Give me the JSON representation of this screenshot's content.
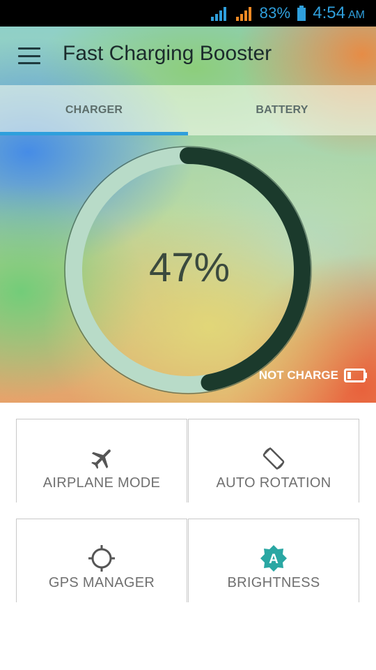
{
  "status_bar": {
    "battery_percent": "83%",
    "time": "4:54",
    "ampm": "AM",
    "color": "#2f9fdc"
  },
  "header": {
    "title": "Fast Charging Booster",
    "menu_icon": "hamburger-menu-icon"
  },
  "tabs": [
    {
      "label": "CHARGER",
      "selected": true
    },
    {
      "label": "BATTERY",
      "selected": false
    }
  ],
  "gauge": {
    "percent_text": "47%",
    "level": 0.47,
    "filled_color": "#1b3a2c",
    "track_color": "#b8dbc8",
    "status_text": "NOT CHARGE",
    "status_icon": "battery-outline-icon"
  },
  "toggles": [
    {
      "label": "AIRPLANE MODE",
      "icon": "airplane-icon"
    },
    {
      "label": "AUTO ROTATION",
      "icon": "screen-rotation-icon"
    },
    {
      "label": "GPS MANAGER",
      "icon": "gps-crosshair-icon"
    },
    {
      "label": "BRIGHTNESS",
      "icon": "auto-brightness-icon",
      "icon_color": "#2aa7a3"
    }
  ]
}
